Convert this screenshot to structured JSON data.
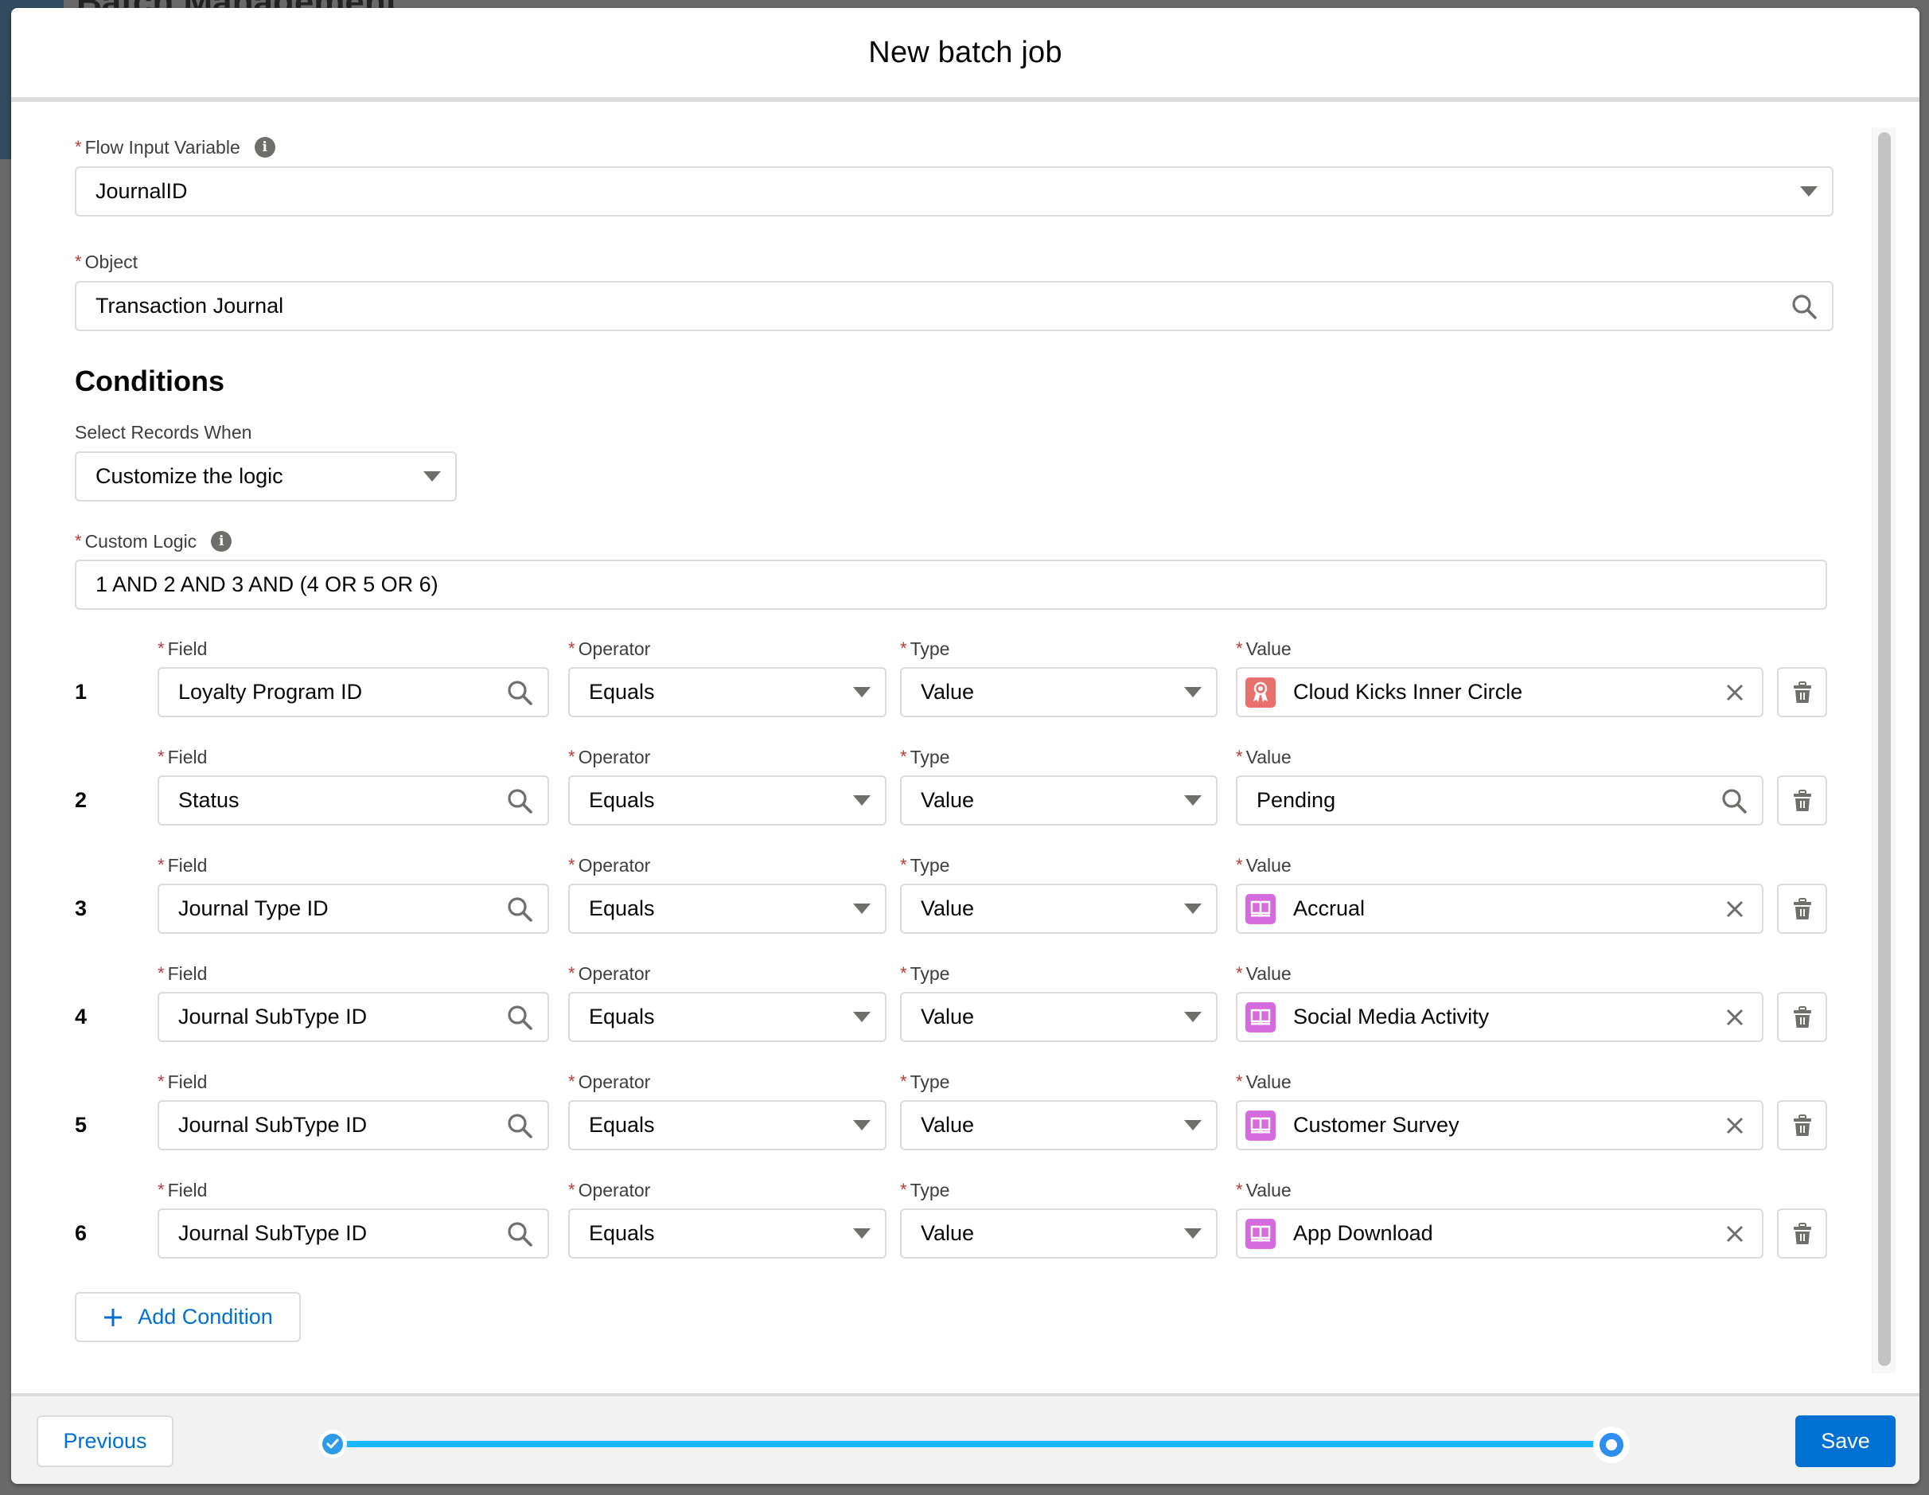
{
  "background": {
    "page_title": "Batch Management"
  },
  "modal": {
    "title": "New batch job",
    "flow_input_variable": {
      "label": "Flow Input Variable",
      "required_marker": "*",
      "value": "JournalID",
      "info_icon": "info-icon",
      "control": "select"
    },
    "object": {
      "label": "Object",
      "required_marker": "*",
      "value": "Transaction Journal",
      "control": "lookup"
    },
    "conditions": {
      "heading": "Conditions",
      "select_records_when": {
        "label": "Select Records When",
        "value": "Customize the logic"
      },
      "custom_logic": {
        "label": "Custom Logic",
        "required_marker": "*",
        "value": "1 AND 2 AND 3 AND (4 OR 5 OR 6)"
      },
      "column_labels": {
        "field": "Field",
        "operator": "Operator",
        "type": "Type",
        "value": "Value"
      },
      "rows": [
        {
          "number": "1",
          "field": "Loyalty Program ID",
          "operator": "Equals",
          "type": "Value",
          "value": "Cloud Kicks Inner Circle",
          "value_icon": "loyalty-program-icon",
          "value_icon_color": "#e8716e",
          "value_control": "selected-record"
        },
        {
          "number": "2",
          "field": "Status",
          "operator": "Equals",
          "type": "Value",
          "value": "Pending",
          "value_icon": "",
          "value_control": "lookup"
        },
        {
          "number": "3",
          "field": "Journal Type ID",
          "operator": "Equals",
          "type": "Value",
          "value": "Accrual",
          "value_icon": "book-icon",
          "value_icon_color": "#d46ce0",
          "value_control": "selected-record"
        },
        {
          "number": "4",
          "field": "Journal SubType ID",
          "operator": "Equals",
          "type": "Value",
          "value": "Social Media Activity",
          "value_icon": "book-icon",
          "value_icon_color": "#d46ce0",
          "value_control": "selected-record"
        },
        {
          "number": "5",
          "field": "Journal SubType ID",
          "operator": "Equals",
          "type": "Value",
          "value": "Customer Survey",
          "value_icon": "book-icon",
          "value_icon_color": "#d46ce0",
          "value_control": "selected-record"
        },
        {
          "number": "6",
          "field": "Journal SubType ID",
          "operator": "Equals",
          "type": "Value",
          "value": "App Download",
          "value_icon": "book-icon",
          "value_icon_color": "#d46ce0",
          "value_control": "selected-record"
        }
      ],
      "add_condition_label": "Add Condition"
    },
    "footer": {
      "previous_label": "Previous",
      "save_label": "Save",
      "progress": {
        "total_steps": 2,
        "current_step": 2,
        "completed_steps": 1,
        "percent": 100
      }
    }
  },
  "colors": {
    "brand": "#0070d2",
    "required": "#c23934",
    "progress": "#1ab9ff",
    "border": "#dddbda"
  }
}
